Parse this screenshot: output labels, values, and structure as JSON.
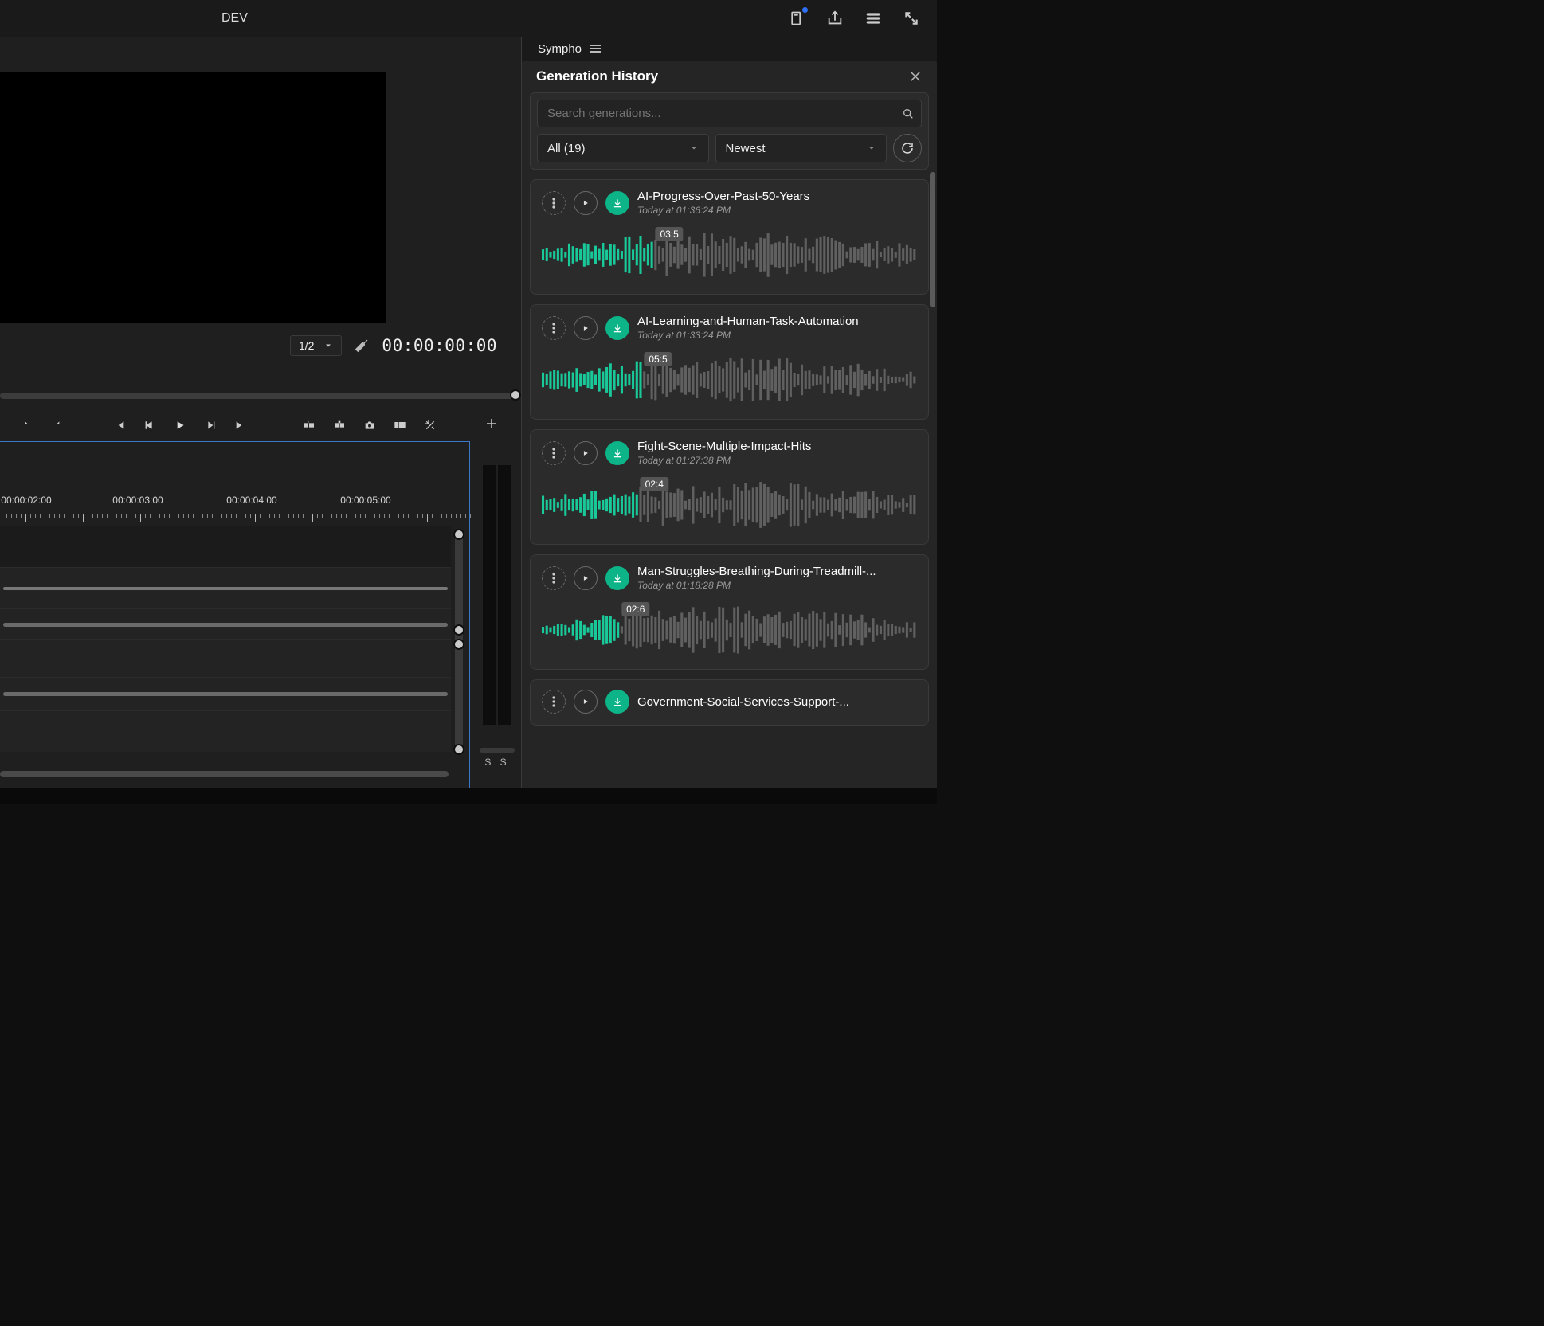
{
  "topbar": {
    "title": "DEV"
  },
  "preview": {
    "ratio": "1/2",
    "timecode": "00:00:00:00"
  },
  "timeline": {
    "marks": [
      "00:00:02:00",
      "00:00:03:00",
      "00:00:04:00",
      "00:00:05:00"
    ]
  },
  "meter": {
    "labels": "S S"
  },
  "panel": {
    "name": "Sympho",
    "title": "Generation History",
    "search_placeholder": "Search generations...",
    "filter_label": "All (19)",
    "sort_label": "Newest"
  },
  "items": [
    {
      "title": "AI-Progress-Over-Past-50-Years",
      "timestamp": "Today at 01:36:24 PM",
      "badge": "03:5",
      "progress": 0.3
    },
    {
      "title": "AI-Learning-and-Human-Task-Automation",
      "timestamp": "Today at 01:33:24 PM",
      "badge": "05:5",
      "progress": 0.27
    },
    {
      "title": "Fight-Scene-Multiple-Impact-Hits",
      "timestamp": "Today at 01:27:38 PM",
      "badge": "02:4",
      "progress": 0.26
    },
    {
      "title": "Man-Struggles-Breathing-During-Treadmill-...",
      "timestamp": "Today at 01:18:28 PM",
      "badge": "02:6",
      "progress": 0.21
    },
    {
      "title": "Government-Social-Services-Support-...",
      "timestamp": "",
      "badge": "",
      "progress": 0
    }
  ],
  "colors": {
    "accent": "#0db488"
  }
}
